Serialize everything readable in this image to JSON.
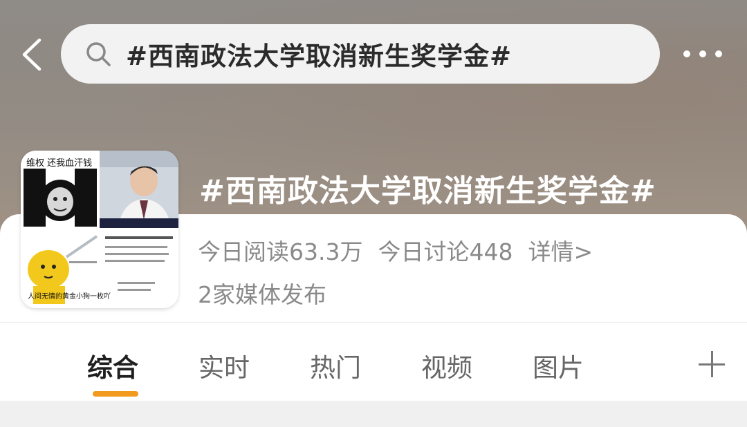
{
  "header": {
    "search_query": "#西南政法大学取消新生奖学金#",
    "back_icon": "chevron-left-icon",
    "search_icon": "search-icon",
    "more_icon": "more-horizontal-icon"
  },
  "topic": {
    "title": "#西南政法大学取消新生奖学金#",
    "today_reads": "今日阅读63.3万",
    "today_discussions": "今日讨论448",
    "details_link": "详情>",
    "media_count": "2家媒体发布",
    "thumbnail_caption_top": "维权 还我血汗钱",
    "thumbnail_caption_bottom": "人间无情的黄金小狗一枚吖"
  },
  "tabs": [
    {
      "label": "综合",
      "active": true
    },
    {
      "label": "实时",
      "active": false
    },
    {
      "label": "热门",
      "active": false
    },
    {
      "label": "视频",
      "active": false
    },
    {
      "label": "图片",
      "active": false
    }
  ],
  "colors": {
    "accent": "#f29a1e",
    "header_text": "#ffffff",
    "secondary_text": "#8a8a8a"
  }
}
